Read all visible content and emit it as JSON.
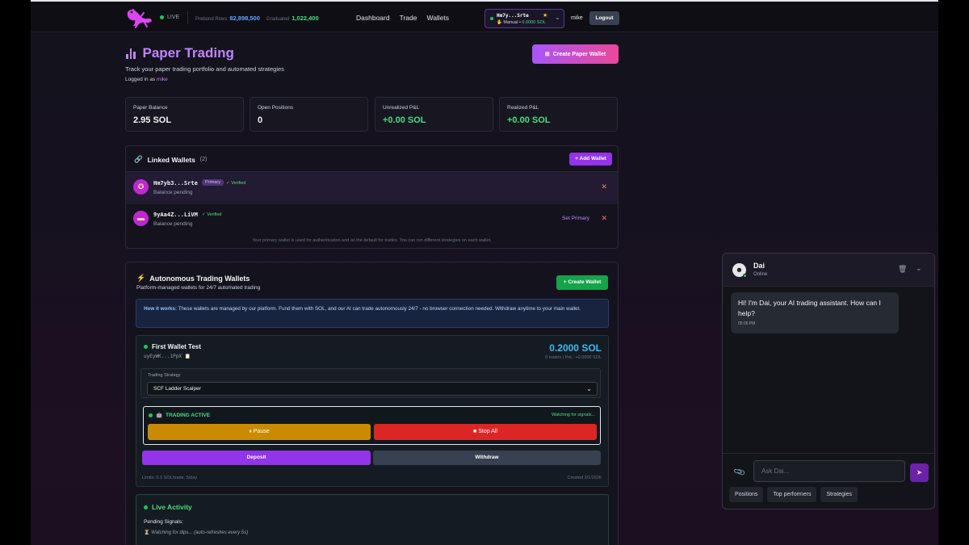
{
  "nav": {
    "status": "LIVE",
    "prebond_label": "Prebond Rows",
    "prebond_value": "82,898,500",
    "graduated_label": "Graduated",
    "graduated_value": "1,022,400",
    "links": [
      "Dashboard",
      "Trade",
      "Wallets"
    ],
    "wallet_address": "Hm7y...Srte",
    "wallet_mode": "Manual",
    "wallet_balance": "0.0000 SOL",
    "username": "mike",
    "logout_label": "Logout"
  },
  "header": {
    "title": "Paper Trading",
    "subtitle": "Track your paper trading portfolio and automated strategies",
    "logged_in_prefix": "Logged in as",
    "logged_in_user": "mike",
    "create_button": "Create Paper Wallet"
  },
  "stats": [
    {
      "label": "Paper Balance",
      "value": "2.95 SOL"
    },
    {
      "label": "Open Positions",
      "value": "0"
    },
    {
      "label": "Unrealized P&L",
      "value": "+0.00 SOL"
    },
    {
      "label": "Realized P&L",
      "value": "+0.00 SOL"
    }
  ],
  "linked_wallets": {
    "title": "Linked Wallets",
    "count": "(2)",
    "add_button": "+ Add Wallet",
    "wallets": [
      {
        "address": "Hm7yb3...Srte",
        "badge": "Primary",
        "verified": "✓ Verified",
        "balance": "Balance pending"
      },
      {
        "address": "9yAa4Z...LiVM",
        "verified": "✓ Verified",
        "balance": "Balance pending",
        "action": "Set Primary"
      }
    ],
    "note": "Your primary wallet is used for authentication and as the default for trades. You can run different strategies on each wallet."
  },
  "autonomous": {
    "title": "Autonomous Trading Wallets",
    "subtitle": "Platform-managed wallets for 24/7 automated trading",
    "create_button": "+ Create Wallet",
    "how_label": "How it works:",
    "how_text": "These wallets are managed by our platform. Fund them with SOL, and our AI can trade autonomously 24/7 - no browser connection needed. Withdraw anytime to your main wallet.",
    "wallet": {
      "name": "First Wallet Test",
      "address": "uyEyWK...1PpX",
      "balance": "0.2000 SOL",
      "meta": "0 trades | PnL: +0.0000 SOL",
      "strategy_label": "Trading Strategy",
      "strategy_value": "SCF Ladder Scalper",
      "status": "TRADING ACTIVE",
      "watching": "Watching for signals...",
      "pause_label": "Pause",
      "stop_label": "Stop All",
      "deposit_label": "Deposit",
      "withdraw_label": "Withdraw",
      "limits": "Limits: 0.1 SOL/trade, 5/day",
      "created": "Created 2/1/2026"
    },
    "live_activity": {
      "title": "Live Activity",
      "pending_label": "Pending Signals:",
      "watching_text": "Watching for dips... (auto-refreshes every 5s)"
    }
  },
  "chat": {
    "name": "Dai",
    "status": "Online",
    "message": "Hi! I'm Dai, your AI trading assistant. How can I help?",
    "message_time": "05:06 PM",
    "input_placeholder": "Ask Dai...",
    "quick_actions": [
      "Positions",
      "Top performers",
      "Strategies"
    ]
  },
  "colors": {
    "accent_purple": "#9333ea",
    "title_purple": "#c084fc",
    "success_green": "#4ade80",
    "danger_red": "#dc2626",
    "warning_yellow": "#ca8a04",
    "balance_blue": "#38bdf8"
  },
  "icons": [
    "gecko-logo-icon",
    "chart-bars-icon",
    "link-icon",
    "bolt-icon",
    "trash-icon",
    "paperclip-icon",
    "send-icon"
  ]
}
